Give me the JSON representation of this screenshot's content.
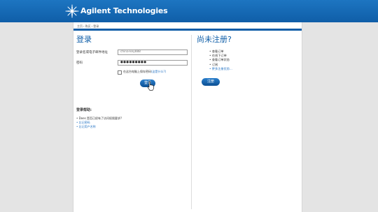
{
  "header": {
    "brand": "Agilent Technologies",
    "logo_icon": "agilent-spark-icon",
    "colors": {
      "bar": "#1368b6",
      "accent": "#0f5ea8",
      "link": "#1e6fc2"
    }
  },
  "breadcrumb": [
    "主页",
    "购买",
    "登录"
  ],
  "login": {
    "title": "登录",
    "username_label": "登录名或电子邮件地址",
    "username_value": "china-key888",
    "password_label": "密码",
    "password_value": "●●●●●●●●●",
    "remember_text": "在这台电脑上保存密码",
    "remember_link": "(这是什么?)",
    "submit_label": "登录"
  },
  "help": {
    "title": "登录帮助:",
    "intro": "• Does 是否已经有了访问权限要求?",
    "forgot_password": "• 忘记密码",
    "forgot_username": "• 忘记用户名称"
  },
  "register": {
    "title": "尚未注册?",
    "benefits": [
      "查看订单",
      "在线下订单",
      "查看订单状态",
      "订阅"
    ],
    "more_link": "• 更多注册优势...",
    "button_label": "注册"
  }
}
